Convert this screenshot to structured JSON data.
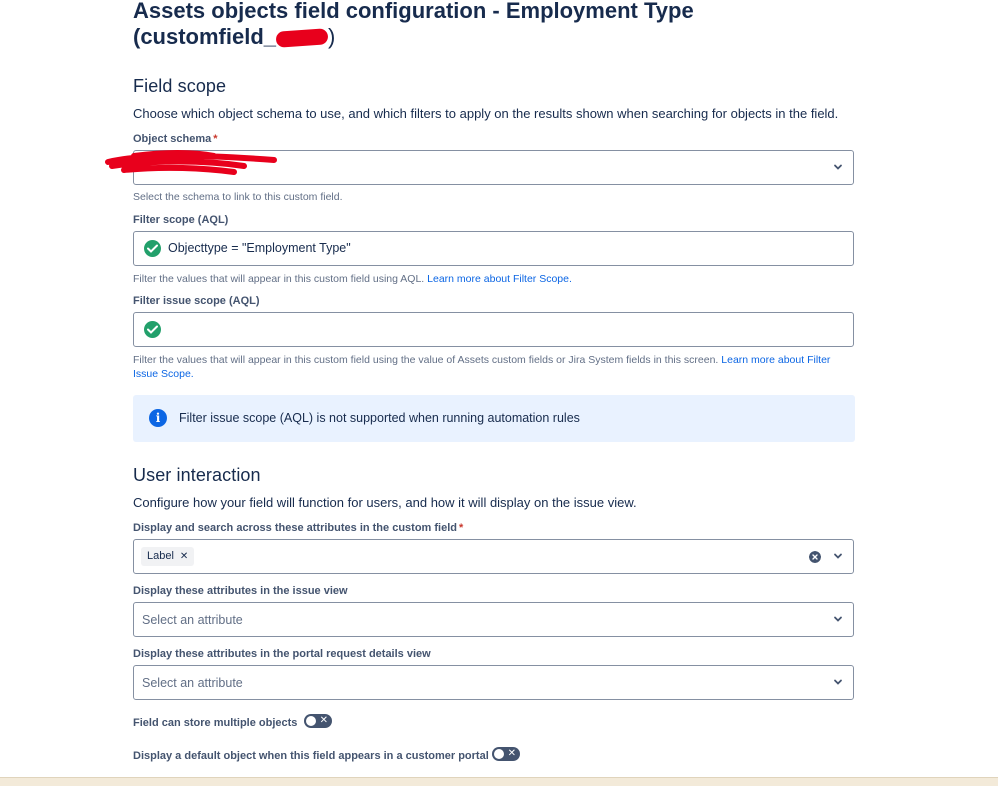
{
  "header": {
    "title_line1": "Assets objects field configuration - Employment Type",
    "title_line2": "(customfield_"
  },
  "field_scope": {
    "heading": "Field scope",
    "description": "Choose which object schema to use, and which filters to apply on the results shown when searching for objects in the field.",
    "object_schema": {
      "label": "Object schema",
      "required_mark": "*",
      "value": "",
      "help": "Select the schema to link to this custom field."
    },
    "filter_scope": {
      "label": "Filter scope (AQL)",
      "value": "Objecttype = \"Employment Type\"",
      "help": "Filter the values that will appear in this custom field using AQL. ",
      "help_link": "Learn more about Filter Scope."
    },
    "filter_issue_scope": {
      "label": "Filter issue scope (AQL)",
      "value": "",
      "help": "Filter the values that will appear in this custom field using the value of Assets custom fields or Jira System fields in this screen. ",
      "help_link": "Learn more about Filter Issue Scope."
    },
    "info_message": "Filter issue scope (AQL) is not supported when running automation rules"
  },
  "user_interaction": {
    "heading": "User interaction",
    "description": "Configure how your field will function for users, and how it will display on the issue view.",
    "display_search": {
      "label": "Display and search across these attributes in the custom field",
      "required_mark": "*",
      "tags": [
        "Label"
      ]
    },
    "issue_view": {
      "label": "Display these attributes in the issue view",
      "placeholder": "Select an attribute"
    },
    "portal_view": {
      "label": "Display these attributes in the portal request details view",
      "placeholder": "Select an attribute"
    },
    "multiple_objects": {
      "label": "Field can store multiple objects",
      "on": false
    },
    "default_object": {
      "label": "Display a default object when this field appears in a customer portal",
      "on": false
    }
  },
  "colors": {
    "text": "#172b4d",
    "link": "#0c66e4",
    "success": "#22a06b",
    "info_bg": "#e9f2ff",
    "redaction": "#e8001c"
  },
  "icons": [
    "check-circle-icon",
    "chevron-down-icon",
    "info-icon",
    "clear-icon",
    "close-icon"
  ]
}
